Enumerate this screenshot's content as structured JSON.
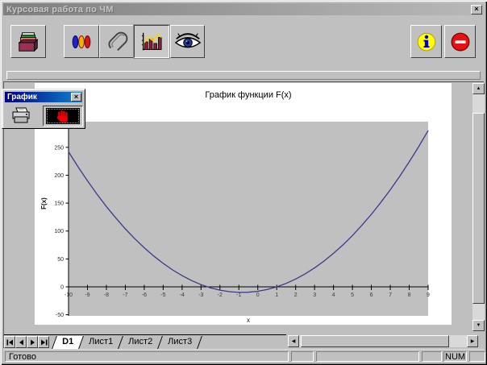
{
  "window": {
    "title": "Курсовая работа по ЧМ",
    "close_glyph": "×"
  },
  "toolbar": {
    "buttons": [
      {
        "icon": "card-file-icon",
        "pressed": false
      },
      {
        "icon": "colored-pills-icon",
        "pressed": false
      },
      {
        "icon": "paperclip-icon",
        "pressed": false
      },
      {
        "icon": "bar-chart-icon",
        "pressed": true
      },
      {
        "icon": "eye-icon",
        "pressed": false
      },
      {
        "icon": "info-icon",
        "pressed": false
      },
      {
        "icon": "stop-icon",
        "pressed": false
      }
    ]
  },
  "graph_toolbox": {
    "title": "График",
    "close_glyph": "×",
    "buttons": [
      {
        "icon": "printer-icon",
        "pressed": false
      },
      {
        "icon": "stop-hand-icon",
        "pressed": true
      }
    ]
  },
  "chart_data": {
    "type": "line",
    "title": "График функции F(x)",
    "xlabel": "x",
    "ylabel": "F(x)",
    "xlim": [
      -10,
      9
    ],
    "ylim": [
      -52,
      296
    ],
    "x_ticks": [
      -10,
      -9,
      -8,
      -7,
      -6,
      -5,
      -4,
      -3,
      -2,
      -1,
      0,
      1,
      2,
      3,
      4,
      5,
      6,
      7,
      8,
      9
    ],
    "y_ticks": [
      -50,
      0,
      50,
      100,
      150,
      200,
      250
    ],
    "grid": false,
    "legend": false,
    "plot_bg": "#c0c0c0",
    "line_color": "#3a3a8a",
    "series": [
      {
        "name": "F(x)",
        "points": [
          [
            -10,
            242
          ],
          [
            -9.5,
            215.25
          ],
          [
            -9,
            190
          ],
          [
            -8.5,
            166.25
          ],
          [
            -8,
            144
          ],
          [
            -7.5,
            123.25
          ],
          [
            -7,
            104
          ],
          [
            -6.5,
            86.25
          ],
          [
            -6,
            70
          ],
          [
            -5.5,
            55.25
          ],
          [
            -5,
            42
          ],
          [
            -4.5,
            30.25
          ],
          [
            -4,
            20
          ],
          [
            -3.5,
            11.25
          ],
          [
            -3,
            4
          ],
          [
            -2.5,
            -1.75
          ],
          [
            -2,
            -6
          ],
          [
            -1.5,
            -8.75
          ],
          [
            -1,
            -10
          ],
          [
            -0.5,
            -9.75
          ],
          [
            0,
            -8
          ],
          [
            0.5,
            -4.75
          ],
          [
            1,
            0
          ],
          [
            1.5,
            6.25
          ],
          [
            2,
            14
          ],
          [
            2.5,
            23.25
          ],
          [
            3,
            34
          ],
          [
            3.5,
            46.25
          ],
          [
            4,
            60
          ],
          [
            4.5,
            75.25
          ],
          [
            5,
            92
          ],
          [
            5.5,
            110.25
          ],
          [
            6,
            130
          ],
          [
            6.5,
            151.25
          ],
          [
            7,
            174
          ],
          [
            7.5,
            198.25
          ],
          [
            8,
            224
          ],
          [
            8.5,
            251.25
          ],
          [
            9,
            280
          ]
        ]
      }
    ]
  },
  "sheet_tabs": {
    "items": [
      {
        "label": "D1",
        "active": true
      },
      {
        "label": "Лист1",
        "active": false
      },
      {
        "label": "Лист2",
        "active": false
      },
      {
        "label": "Лист3",
        "active": false
      }
    ]
  },
  "statusbar": {
    "message": "Готово",
    "num": "NUM"
  }
}
